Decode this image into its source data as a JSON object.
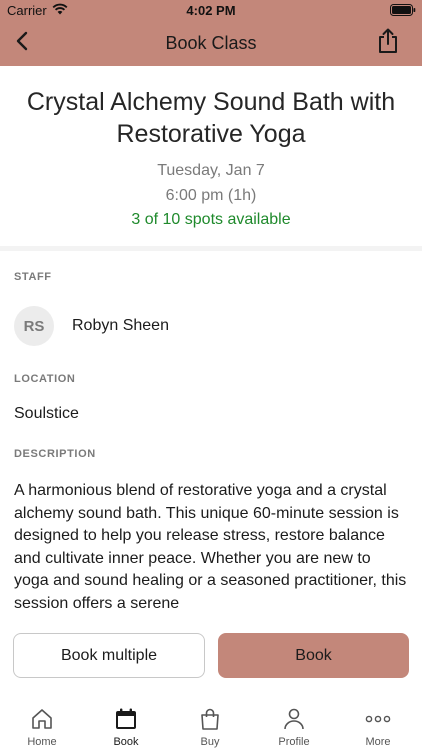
{
  "status_bar": {
    "carrier": "Carrier",
    "time": "4:02 PM"
  },
  "nav": {
    "title": "Book Class",
    "back_icon": "chevron-left-icon",
    "share_icon": "share-icon"
  },
  "class": {
    "title": "Crystal Alchemy Sound Bath with Restorative Yoga",
    "date": "Tuesday, Jan 7",
    "time": "6:00 pm (1h)",
    "availability": "3 of 10 spots available"
  },
  "staff": {
    "label": "STAFF",
    "initials": "RS",
    "name": "Robyn Sheen"
  },
  "location": {
    "label": "LOCATION",
    "value": "Soulstice"
  },
  "description": {
    "label": "DESCRIPTION",
    "text": "A harmonious blend of restorative yoga and a crystal alchemy sound bath. This unique 60-minute session is designed to help you release stress, restore balance and cultivate inner peace. Whether you are new to yoga and sound healing or a seasoned practitioner, this session offers a serene"
  },
  "actions": {
    "book_multiple": "Book multiple",
    "book": "Book"
  },
  "tabs": [
    {
      "label": "Home",
      "icon": "home-icon"
    },
    {
      "label": "Book",
      "icon": "calendar-icon"
    },
    {
      "label": "Buy",
      "icon": "shopping-bag-icon"
    },
    {
      "label": "Profile",
      "icon": "person-icon"
    },
    {
      "label": "More",
      "icon": "more-dots-icon"
    }
  ],
  "colors": {
    "header": "#c3877a",
    "primary_button": "#c3877a",
    "availability_text": "#1f8a2c",
    "secondary_text": "#7a7a7a"
  }
}
